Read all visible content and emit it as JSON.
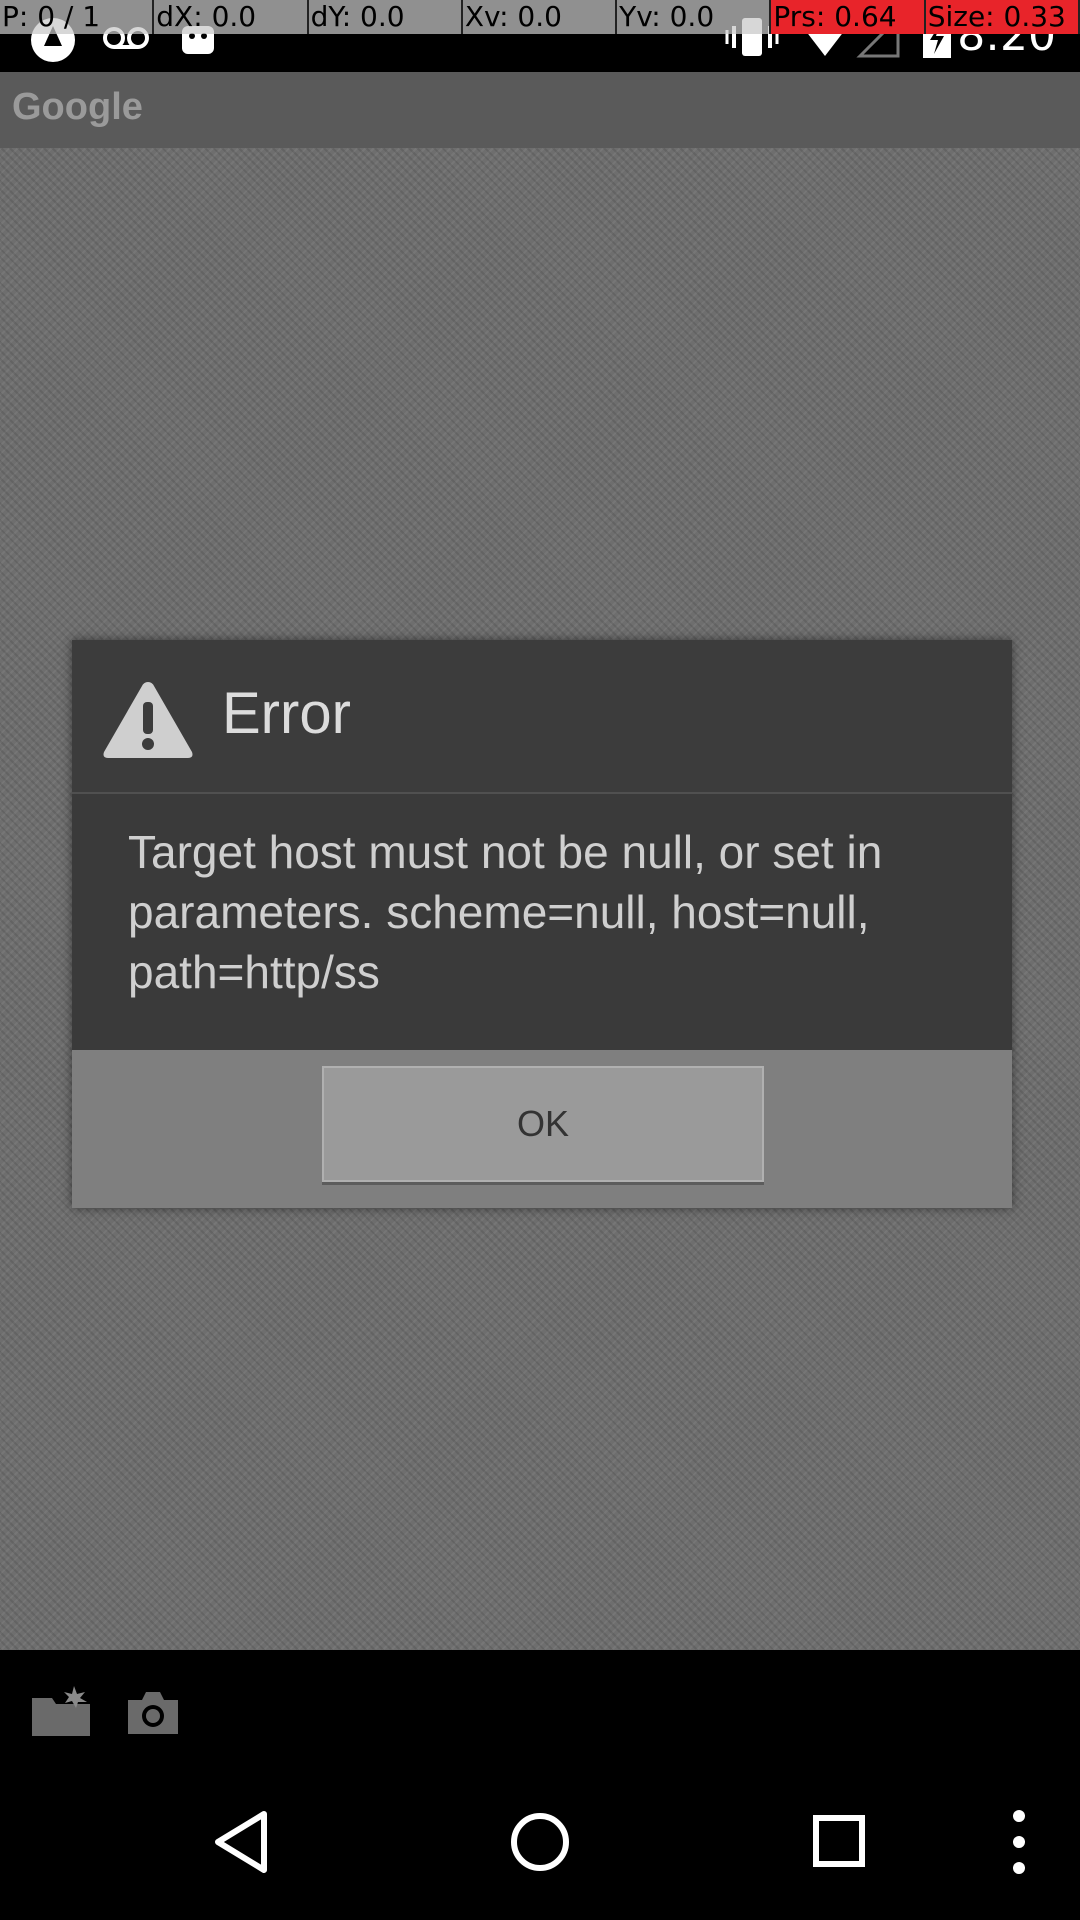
{
  "debug_overlay": {
    "cells": [
      "P: 0 / 1",
      "dX: 0.0",
      "dY: 0.0",
      "Xv: 0.0",
      "Yv: 0.0",
      "Prs: 0.64",
      "Size: 0.33"
    ]
  },
  "status_bar": {
    "time": "8:20",
    "icons": [
      "app-notification-icon",
      "voicemail-icon",
      "android-icon",
      "vibrate-icon",
      "wifi-icon",
      "signal-icon",
      "battery-icon"
    ]
  },
  "app_bar": {
    "title": "Google"
  },
  "dialog": {
    "title": "Error",
    "icon": "warning-icon",
    "message": "Target host must not be null, or set in parameters. scheme=null, host=null, path=http/ss",
    "ok_label": "OK"
  },
  "tray": {
    "icons": [
      "folder-icon",
      "camera-icon"
    ]
  },
  "nav": {
    "icons": [
      "back-icon",
      "home-icon",
      "recents-icon",
      "menu-icon"
    ]
  },
  "colors": {
    "debug_highlight": "#e8242a",
    "dialog_header": "#3c3c3c",
    "dialog_footer": "#7f7f7f"
  }
}
